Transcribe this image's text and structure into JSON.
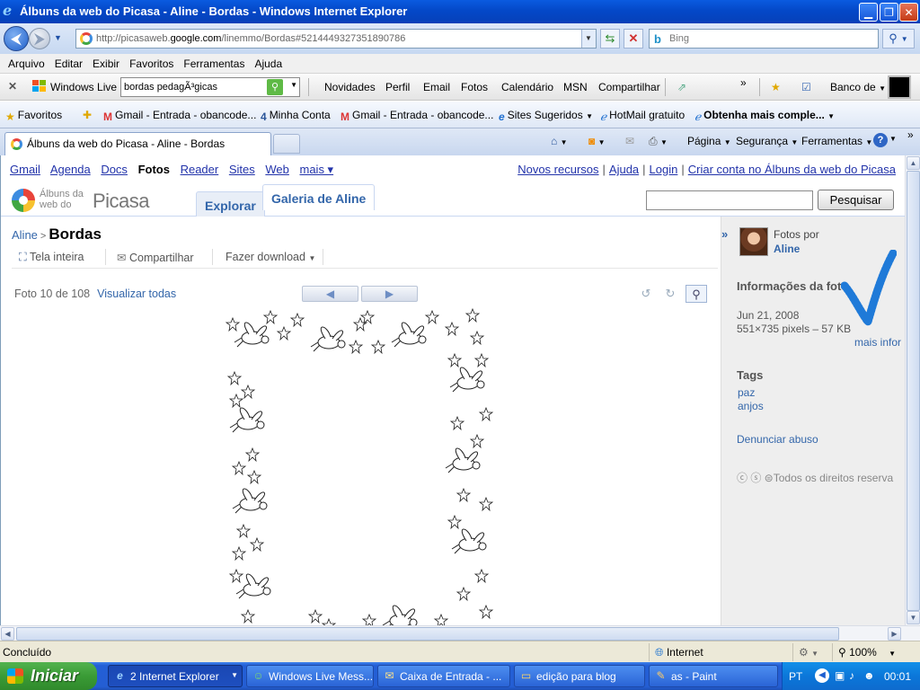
{
  "window": {
    "title": "Álbuns da web do Picasa - Aline - Bordas - Windows Internet Explorer"
  },
  "address": {
    "url_gray": "http://picasaweb.",
    "url_host": "google.com",
    "url_rest": "/linemmo/Bordas#5214449327351890786",
    "search_placeholder": "Bing"
  },
  "menu": [
    "Arquivo",
    "Editar",
    "Exibir",
    "Favoritos",
    "Ferramentas",
    "Ajuda"
  ],
  "live_toolbar": {
    "brand": "Windows Live",
    "search_value": "bordas pedagÃ³gicas",
    "links": [
      "Novidades",
      "Perfil",
      "Email",
      "Fotos",
      "Calendário",
      "MSN",
      "Compartilhar"
    ],
    "bank": "Banco de"
  },
  "favorites": {
    "label": "Favoritos",
    "items": [
      "Gmail - Entrada - obancode...",
      "Minha Conta",
      "Gmail - Entrada - obancode...",
      "Sites Sugeridos",
      "HotMail gratuito",
      "Obtenha mais comple..."
    ]
  },
  "tabs": {
    "active": "Álbuns da web do Picasa - Aline - Bordas"
  },
  "commands": {
    "page": "Página",
    "security": "Segurança",
    "tools": "Ferramentas"
  },
  "gbar": {
    "left": [
      "Gmail",
      "Agenda",
      "Docs",
      "Fotos",
      "Reader",
      "Sites",
      "Web",
      "mais ▾"
    ],
    "right": [
      "Novos recursos",
      "Ajuda",
      "Login",
      "Criar conta no Álbuns da web do Picasa"
    ]
  },
  "picasa": {
    "logo_small_1": "Álbuns da",
    "logo_small_2": "web do",
    "logo_big": "Picasa",
    "tab_explore": "Explorar",
    "tab_gallery": "Galeria de Aline",
    "search_button": "Pesquisar"
  },
  "breadcrumb": {
    "user": "Aline",
    "album": "Bordas"
  },
  "actions": {
    "fullscreen": "Tela inteira",
    "share": "Compartilhar",
    "download": "Fazer download"
  },
  "photo_nav": {
    "counter": "Foto 10 de 108",
    "view_all": "Visualizar todas"
  },
  "sidebar": {
    "photos_by": "Fotos por",
    "owner": "Aline",
    "info_title": "Informações da foto",
    "date": "Jun 21, 2008",
    "dims": "551×735 pixels – 57 KB",
    "more_info": "mais infor",
    "tags_title": "Tags",
    "tags": [
      "paz",
      "anjos"
    ],
    "report": "Denunciar abuso",
    "rights": "Todos os direitos reserva"
  },
  "statusbar": {
    "text": "Concluído",
    "zone": "Internet",
    "zoom": "100%"
  },
  "taskbar": {
    "start": "Iniciar",
    "items": [
      "2 Internet Explorer",
      "Windows Live Mess...",
      "Caixa de Entrada - ...",
      "edição para blog",
      "as - Paint"
    ],
    "lang": "PT",
    "clock": "00:01"
  }
}
